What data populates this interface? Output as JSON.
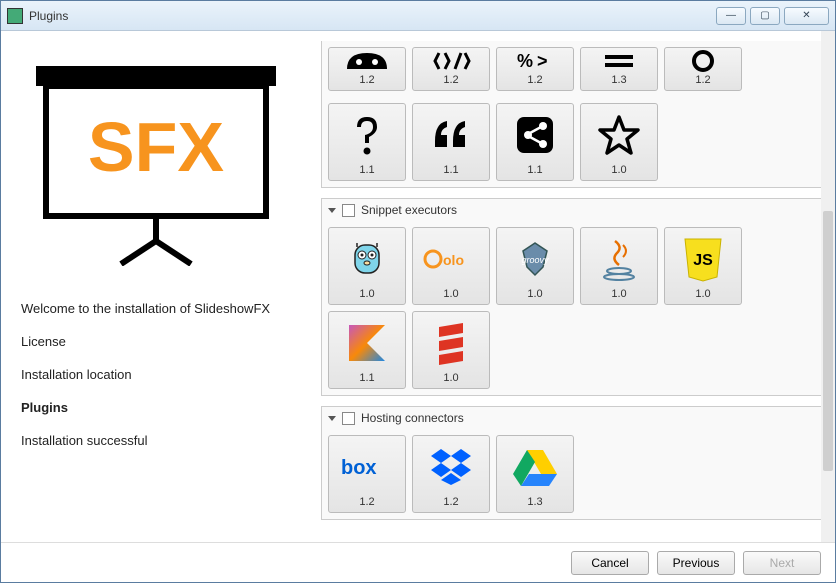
{
  "window": {
    "title": "Plugins"
  },
  "sidebar": {
    "welcome": "Welcome to the installation of SlideshowFX",
    "items": [
      "License",
      "Installation location",
      "Plugins",
      "Installation successful"
    ],
    "active_index": 2
  },
  "sections": {
    "row1": [
      {
        "ver": "1.2"
      },
      {
        "ver": "1.2"
      },
      {
        "ver": "1.2"
      },
      {
        "ver": "1.3"
      },
      {
        "ver": "1.2"
      }
    ],
    "row2": [
      {
        "ver": "1.1"
      },
      {
        "ver": "1.1"
      },
      {
        "ver": "1.1"
      },
      {
        "ver": "1.0"
      }
    ],
    "snippet": {
      "title": "Snippet executors",
      "tiles": [
        {
          "name": "go",
          "ver": "1.0"
        },
        {
          "name": "golo",
          "ver": "1.0"
        },
        {
          "name": "groovy",
          "ver": "1.0"
        },
        {
          "name": "java",
          "ver": "1.0"
        },
        {
          "name": "js",
          "ver": "1.0"
        },
        {
          "name": "kotlin",
          "ver": "1.1"
        },
        {
          "name": "scala",
          "ver": "1.0"
        }
      ]
    },
    "hosting": {
      "title": "Hosting connectors",
      "tiles": [
        {
          "name": "box",
          "ver": "1.2"
        },
        {
          "name": "dropbox",
          "ver": "1.2"
        },
        {
          "name": "gdrive",
          "ver": "1.3"
        }
      ]
    }
  },
  "footer": {
    "cancel": "Cancel",
    "previous": "Previous",
    "next": "Next"
  }
}
